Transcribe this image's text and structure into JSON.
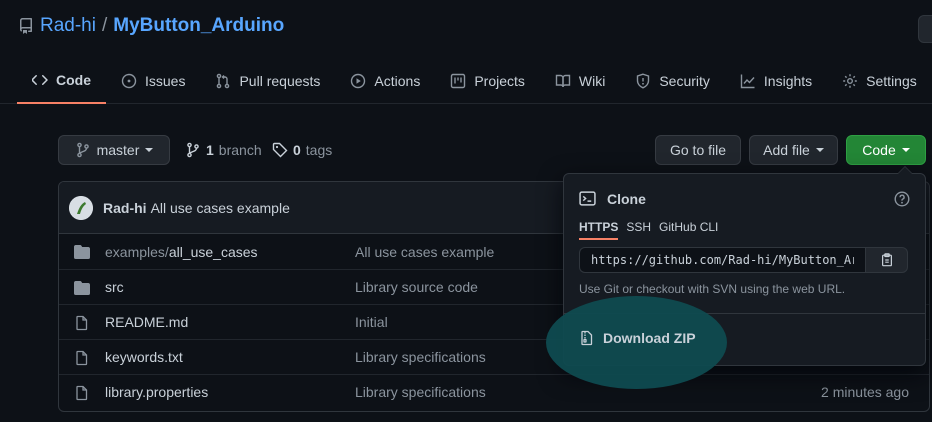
{
  "repo": {
    "owner": "Rad-hi",
    "separator": "/",
    "name": "MyButton_Arduino"
  },
  "tabs": [
    {
      "label": "Code",
      "icon": "code-icon",
      "selected": true
    },
    {
      "label": "Issues",
      "icon": "issue-icon"
    },
    {
      "label": "Pull requests",
      "icon": "pull-request-icon"
    },
    {
      "label": "Actions",
      "icon": "play-icon"
    },
    {
      "label": "Projects",
      "icon": "project-icon"
    },
    {
      "label": "Wiki",
      "icon": "book-icon"
    },
    {
      "label": "Security",
      "icon": "shield-icon"
    },
    {
      "label": "Insights",
      "icon": "graph-icon"
    },
    {
      "label": "Settings",
      "icon": "gear-icon"
    }
  ],
  "branch_bar": {
    "branch": "master",
    "branch_count": "1",
    "branch_word": "branch",
    "tag_count": "0",
    "tag_word": "tags",
    "goto_file": "Go to file",
    "add_file": "Add file",
    "code": "Code"
  },
  "commit": {
    "author": "Rad-hi",
    "message": "All use cases example"
  },
  "files": [
    {
      "dir": "examples/",
      "name": "all_use_cases",
      "type": "folder",
      "message": "All use cases example",
      "time": ""
    },
    {
      "dir": "",
      "name": "src",
      "type": "folder",
      "message": "Library source code",
      "time": ""
    },
    {
      "dir": "",
      "name": "README.md",
      "type": "file",
      "message": "Initial",
      "time": ""
    },
    {
      "dir": "",
      "name": "keywords.txt",
      "type": "file",
      "message": "Library specifications",
      "time": ""
    },
    {
      "dir": "",
      "name": "library.properties",
      "type": "file",
      "message": "Library specifications",
      "time": "2 minutes ago"
    }
  ],
  "clone": {
    "title": "Clone",
    "protocols": [
      "HTTPS",
      "SSH",
      "GitHub CLI"
    ],
    "url": "https://github.com/Rad-hi/MyButton_Arduino.git",
    "help": "Use Git or checkout with SVN using the web URL.",
    "download": "Download ZIP"
  },
  "colors": {
    "accent_link": "#58a6ff",
    "primary_button": "#238636",
    "selected_underline": "#f78166",
    "highlight": "#0f4b50"
  }
}
